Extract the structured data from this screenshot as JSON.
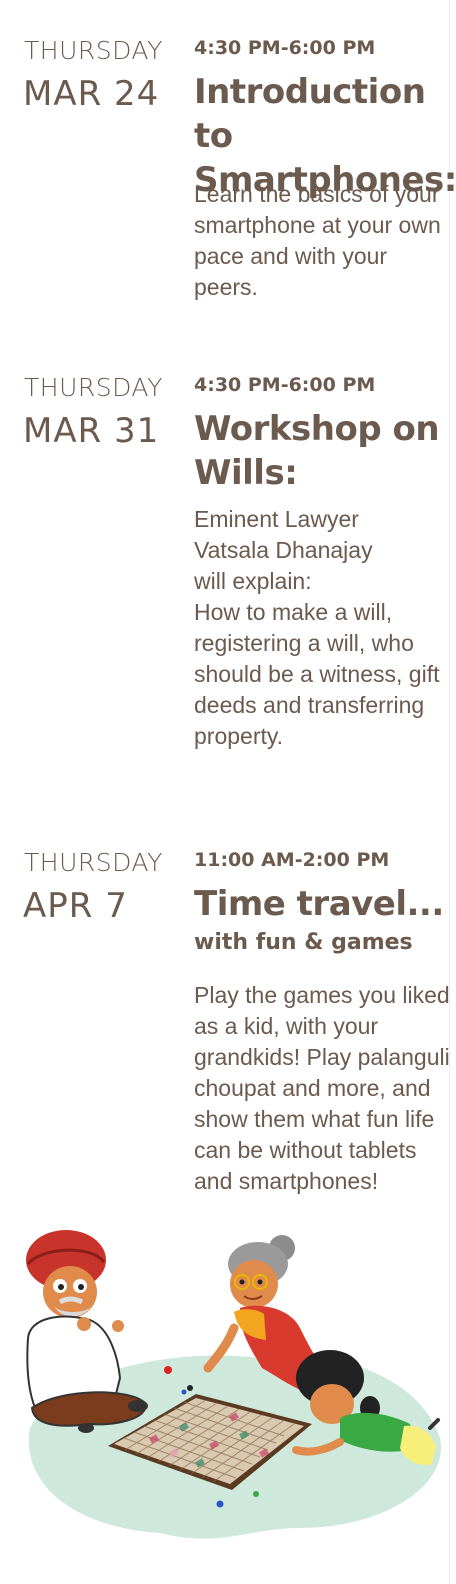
{
  "events": [
    {
      "day": "THURSDAY",
      "date": "MAR 24",
      "time": "4:30 PM-6:00 PM",
      "title": "Introduction to Smartphones:",
      "description": "Learn the basics of your smartphone at your own pace and with your peers."
    },
    {
      "day": "THURSDAY",
      "date": "MAR 31",
      "time": "4:30 PM-6:00 PM",
      "title": "Workshop on Wills:",
      "description_intro": "Eminent Lawyer Vatsala Dhanajay will explain:",
      "description": "How to make a will, registering a will, who should be a witness, gift deeds and transferring property."
    },
    {
      "day": "THURSDAY",
      "date": "APR 7",
      "time": "11:00 AM-2:00 PM",
      "title": "Time travel...",
      "subtitle": "with fun & games",
      "description": "Play the games you liked as a kid, with your grandkids! Play palanguli choupat and more, and show them what fun life can be without tablets and smartphones!"
    }
  ],
  "colors": {
    "text": "#6b5a4e",
    "board_shadow": "#cfe8dc"
  },
  "illustration": {
    "icons": [
      "grandfather-icon",
      "grandmother-icon",
      "child-icon",
      "game-board-icon"
    ]
  }
}
